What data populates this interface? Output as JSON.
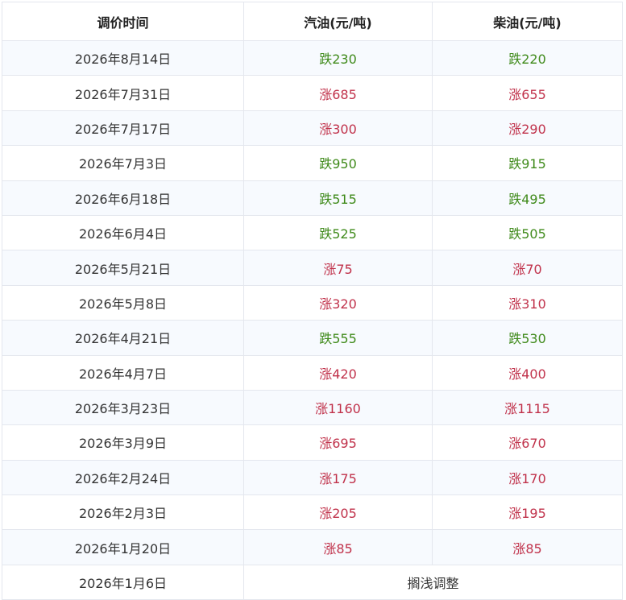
{
  "table": {
    "headers": {
      "date": "调价时间",
      "gasoline": "汽油(元/吨)",
      "diesel": "柴油(元/吨)"
    },
    "rows": [
      {
        "date": "2026年8月14日",
        "gasoline": "跌230",
        "diesel": "跌220"
      },
      {
        "date": "2026年7月31日",
        "gasoline": "涨685",
        "diesel": "涨655"
      },
      {
        "date": "2026年7月17日",
        "gasoline": "涨300",
        "diesel": "涨290"
      },
      {
        "date": "2026年7月3日",
        "gasoline": "跌950",
        "diesel": "跌915"
      },
      {
        "date": "2026年6月18日",
        "gasoline": "跌515",
        "diesel": "跌495"
      },
      {
        "date": "2026年6月4日",
        "gasoline": "跌525",
        "diesel": "跌505"
      },
      {
        "date": "2026年5月21日",
        "gasoline": "涨75",
        "diesel": "涨70"
      },
      {
        "date": "2026年5月8日",
        "gasoline": "涨320",
        "diesel": "涨310"
      },
      {
        "date": "2026年4月21日",
        "gasoline": "跌555",
        "diesel": "跌530"
      },
      {
        "date": "2026年4月7日",
        "gasoline": "涨420",
        "diesel": "涨400"
      },
      {
        "date": "2026年3月23日",
        "gasoline": "涨1160",
        "diesel": "涨1115"
      },
      {
        "date": "2026年3月9日",
        "gasoline": "涨695",
        "diesel": "涨670"
      },
      {
        "date": "2026年2月24日",
        "gasoline": "涨175",
        "diesel": "涨170"
      },
      {
        "date": "2026年2月3日",
        "gasoline": "涨205",
        "diesel": "涨195"
      },
      {
        "date": "2026年1月20日",
        "gasoline": "涨85",
        "diesel": "涨85"
      },
      {
        "date": "2026年1月6日",
        "merged": "搁浅调整"
      }
    ]
  },
  "colors": {
    "rise": "#c0314a",
    "fall": "#3f8a1a",
    "border": "#e4e7ee",
    "stripe": "#f7fafe"
  }
}
